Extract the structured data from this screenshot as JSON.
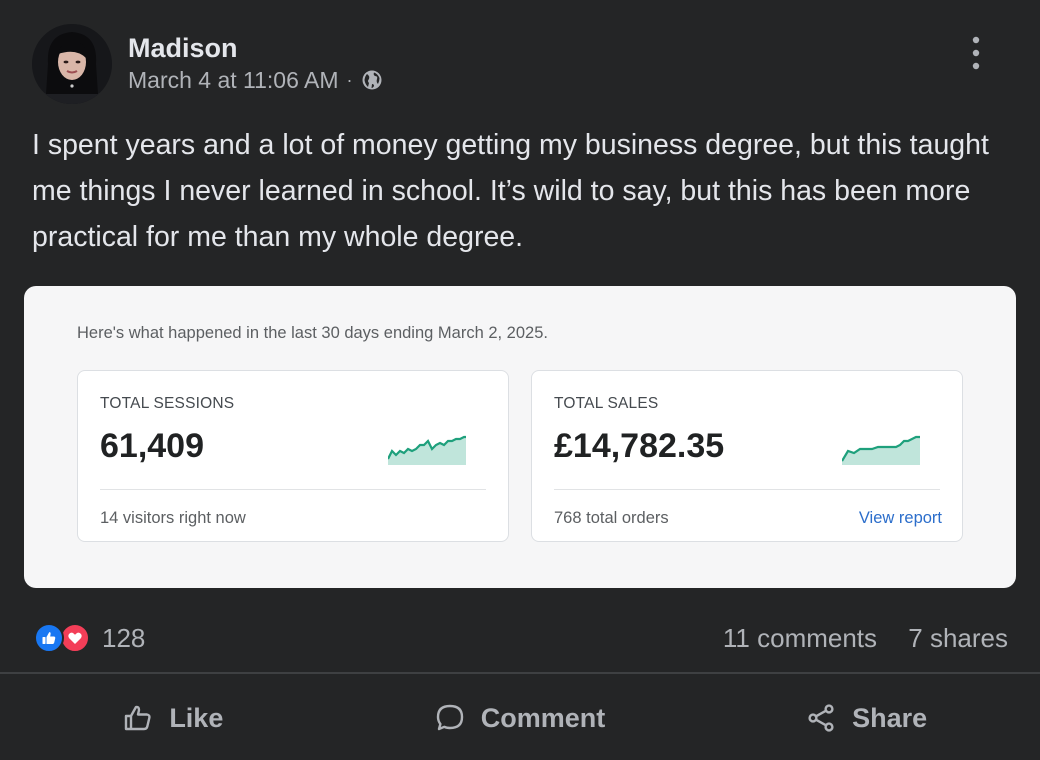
{
  "post": {
    "author": "Madison",
    "timestamp": "March 4 at 11:06 AM",
    "separator": "·",
    "privacy_icon": "globe-icon",
    "text": "I spent years and a lot of money getting my business degree, but this taught me things I never learned in school. It’s wild to say, but this has been more practical for me than my whole degree."
  },
  "card": {
    "intro": "Here's what happened in the last 30 days ending March 2, 2025.",
    "metrics": [
      {
        "label": "TOTAL SESSIONS",
        "value": "61,409",
        "footer": "14 visitors right now",
        "link": ""
      },
      {
        "label": "TOTAL SALES",
        "value": "£14,782.35",
        "footer": "768 total orders",
        "link": "View report"
      }
    ],
    "accent_color": "#1ea07c",
    "link_color": "#2c6ecb"
  },
  "stats": {
    "reaction_icons": [
      "like-icon",
      "love-icon"
    ],
    "reaction_count": "128",
    "comments": "11 comments",
    "shares": "7 shares"
  },
  "actions": {
    "like": "Like",
    "comment": "Comment",
    "share": "Share"
  },
  "colors": {
    "background": "#242526",
    "text": "#e4e6eb",
    "muted": "#b0b3b8",
    "like_blue": "#1877f2",
    "love_red": "#f33e58"
  }
}
